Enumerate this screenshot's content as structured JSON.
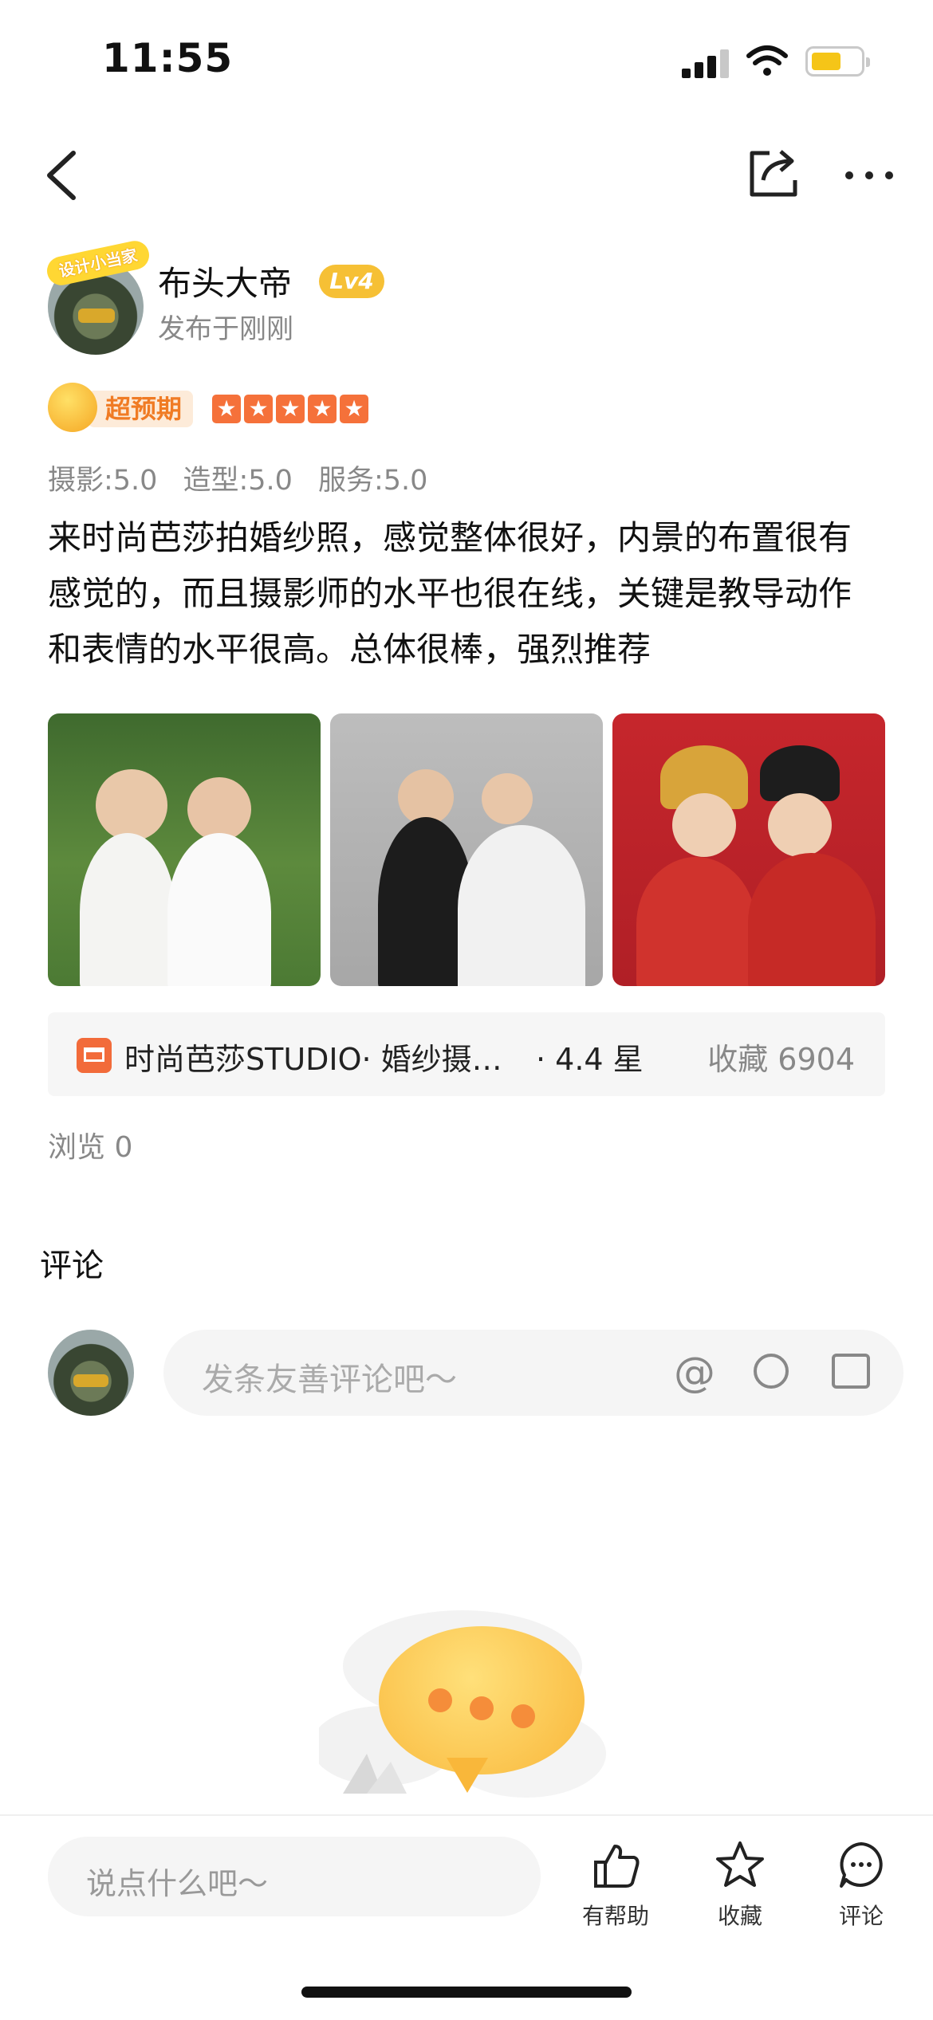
{
  "status_bar": {
    "time": "11:55"
  },
  "author": {
    "badge": "设计小当家",
    "name": "布头大帝",
    "level": "Lv4",
    "posted": "发布于刚刚"
  },
  "rating": {
    "label": "超预期",
    "stars": 5,
    "scores": [
      "摄影:5.0",
      "造型:5.0",
      "服务:5.0"
    ]
  },
  "post": {
    "text": "来时尚芭莎拍婚纱照，感觉整体很好，内景的布置很有感觉的，而且摄影师的水平也很在线，关键是教导动作和表情的水平很高。总体很棒，强烈推荐"
  },
  "store": {
    "name": "时尚芭莎STUDIO· 婚纱摄…",
    "rating": "· 4.4 星",
    "favorites": "收藏 6904"
  },
  "views": "浏览 0",
  "comments": {
    "title": "评论",
    "placeholder": "发条友善评论吧～",
    "at": "@"
  },
  "bottom_bar": {
    "placeholder": "说点什么吧～",
    "helpful": "有帮助",
    "collect": "收藏",
    "comment": "评论"
  },
  "icons": [
    "back-icon",
    "share-icon",
    "more-icon",
    "at-icon",
    "emoji-icon",
    "image-icon",
    "thumbs-up-icon",
    "star-icon",
    "comment-icon"
  ],
  "colors": {
    "accent_orange": "#f5713a",
    "level_gold": "#f6c035"
  }
}
